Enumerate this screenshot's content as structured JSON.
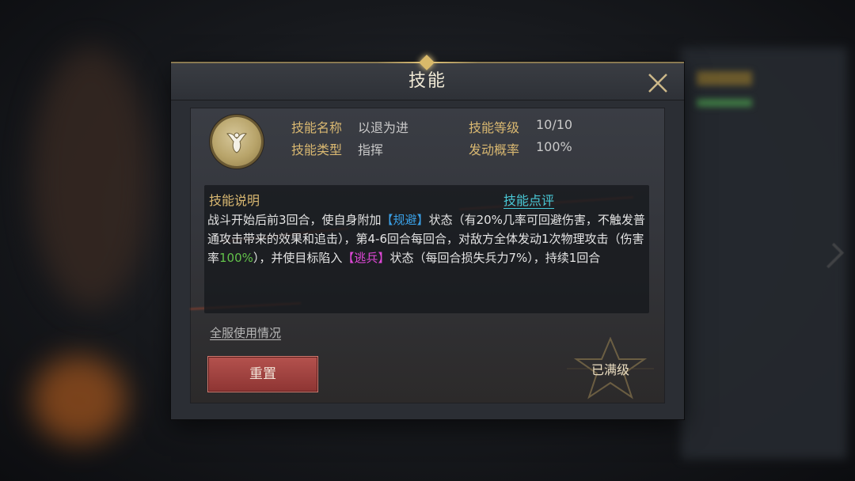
{
  "dialog": {
    "title": "技能",
    "close_icon": "close-icon"
  },
  "skill": {
    "icon": "skill-emblem-icon",
    "name_label": "技能名称",
    "name_value": "以退为进",
    "level_label": "技能等级",
    "level_value": "10/10",
    "type_label": "技能类型",
    "type_value": "指挥",
    "rate_label": "发动概率",
    "rate_value": "100%"
  },
  "description": {
    "title": "技能说明",
    "review_link": "技能点评",
    "segments": [
      {
        "text": "战斗开始后前3回合，使自身附加",
        "style": "normal"
      },
      {
        "text": "【规避】",
        "style": "blue"
      },
      {
        "text": "状态（有20%几率可回避伤害，不触发普通攻击带来的效果和追击），第4-6回合每回合，对敌方全体发动1次物理攻击（伤害率",
        "style": "normal"
      },
      {
        "text": "100%",
        "style": "green"
      },
      {
        "text": "），并使目标陷入",
        "style": "normal"
      },
      {
        "text": "【逃兵】",
        "style": "pink"
      },
      {
        "text": "状态（每回合损失兵力7%），持续1回合",
        "style": "normal"
      }
    ]
  },
  "footer": {
    "usage_link": "全服使用情况",
    "reset_button": "重置",
    "maxed_badge": "已满级"
  },
  "colors": {
    "label_gold": "#d9b871",
    "link_cyan": "#49c8d6",
    "keyword_blue": "#3aa0e6",
    "keyword_green": "#62c24a",
    "keyword_pink": "#e048d8",
    "button_red": "#a4443f"
  }
}
